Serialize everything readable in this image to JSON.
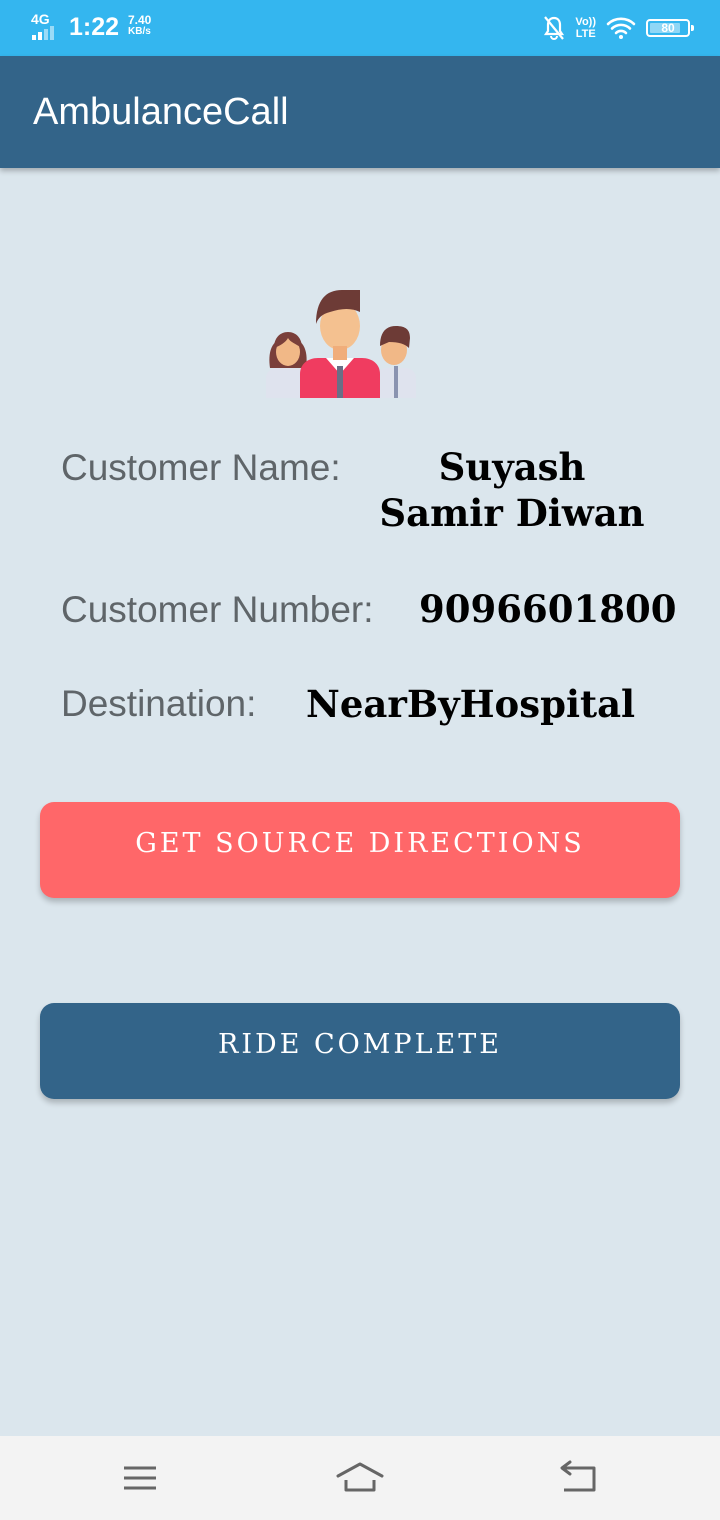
{
  "status_bar": {
    "network": "4G",
    "time": "1:22",
    "speed_value": "7.40",
    "speed_unit": "KB/s",
    "volte_top": "Vo))",
    "volte_bottom": "LTE",
    "battery": "80"
  },
  "app_bar": {
    "title": "AmbulanceCall"
  },
  "details": {
    "name_label": "Customer Name:",
    "name_value": "Suyash Samir Diwan",
    "number_label": "Customer Number:",
    "number_value": "9096601800",
    "destination_label": "Destination:",
    "destination_value": "NearByHospital"
  },
  "buttons": {
    "directions": "GET SOURCE DIRECTIONS",
    "complete": "RIDE COMPLETE"
  },
  "colors": {
    "status_bar": "#34b6ef",
    "app_bar": "#336489",
    "background": "#dbe6ed",
    "directions_button": "#ff6769",
    "complete_button": "#336489"
  },
  "icons": [
    "people-group-icon",
    "menu-icon",
    "home-icon",
    "back-icon",
    "mute-icon",
    "wifi-icon",
    "battery-icon",
    "signal-icon"
  ]
}
